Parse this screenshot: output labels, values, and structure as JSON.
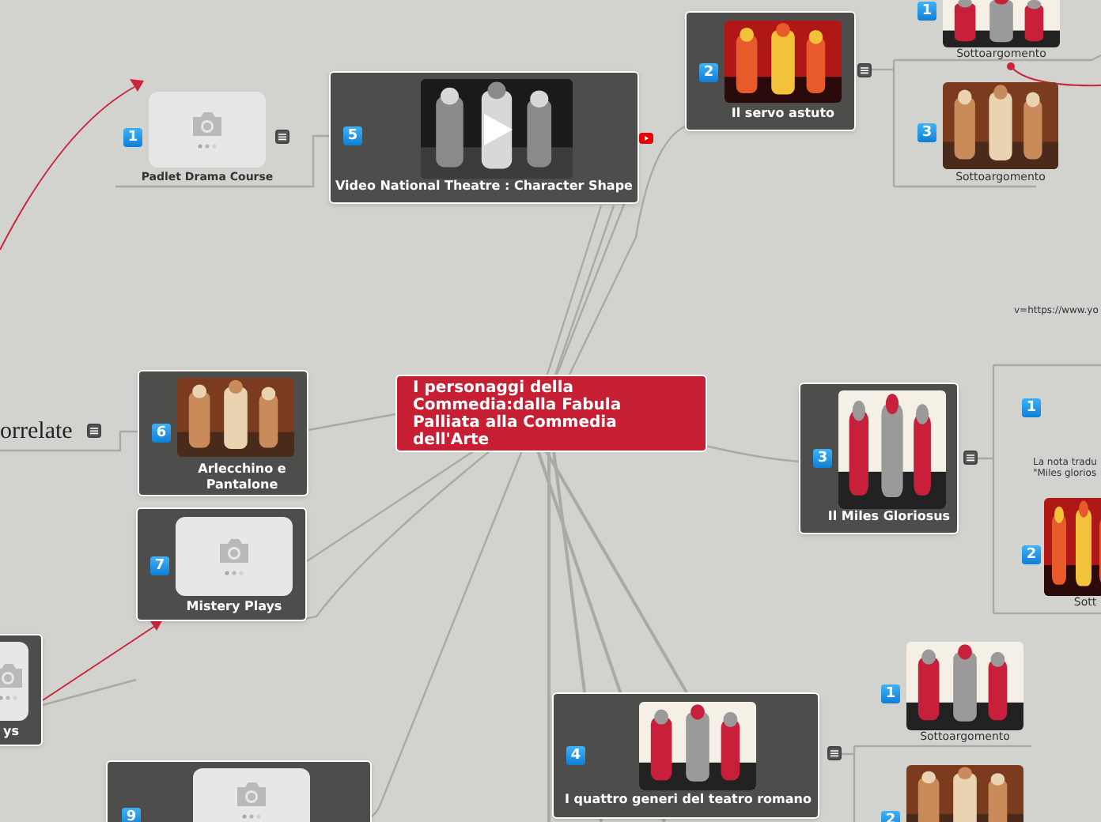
{
  "central": {
    "title": "I personaggi della Commedia:dalla Fabula Palliata alla Commedia dell'Arte"
  },
  "topics": [
    {
      "kind": "link",
      "number": "1",
      "label": "Padlet Drama Course",
      "notes": true
    },
    {
      "kind": "video",
      "number": "5",
      "label": "Video National Theatre : Character Shape",
      "notes": false
    },
    {
      "number": "2",
      "label": "Il servo astuto",
      "notes": true
    },
    {
      "number": "3",
      "label": "Il Miles Gloriosus",
      "notes": true
    },
    {
      "number": "6",
      "label": "Arlecchino e Pantalone",
      "notes": false
    },
    {
      "kind": "blank",
      "number": "7",
      "label": "Mistery  Plays",
      "notes": false
    },
    {
      "kind": "blank",
      "label": "ys",
      "notes": false
    },
    {
      "number": "4",
      "label": "I quattro generi del teatro romano",
      "notes": true
    },
    {
      "kind": "blank",
      "number": "9",
      "notes": false
    }
  ],
  "subtopics": [
    {
      "number": "1",
      "label": "Sottoargomento"
    },
    {
      "number": "3",
      "label": "Sottoargomento"
    },
    {
      "kind": "text",
      "number": "1"
    },
    {
      "number": "2",
      "label": "Sott"
    },
    {
      "number": "1",
      "label": "Sottoargomento"
    },
    {
      "number": "2"
    }
  ],
  "fragments": {
    "related": "orrelate",
    "url": "v=https://www.yo",
    "note_lines": [
      "La nota tradu",
      "\"Miles glorios"
    ]
  }
}
